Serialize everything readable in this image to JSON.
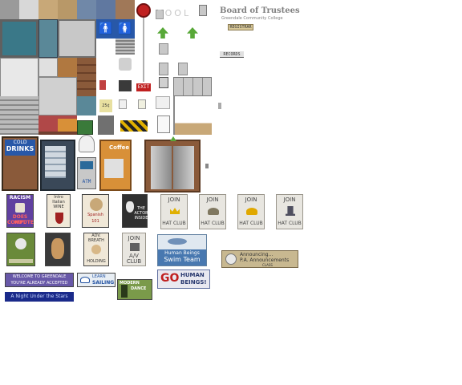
{
  "signs": {
    "pool": "POOL",
    "board_title": "Board of Trustees",
    "board_sub": "Greendale Community College",
    "registrar": "REGISTRAR",
    "records": "RECORDS",
    "exit": "EXIT",
    "cold_drinks_1": "COLD",
    "cold_drinks_2": "DRINKS",
    "coffee": "Coffee",
    "atm": "ATM",
    "price": "25¢"
  },
  "posters": {
    "racism_1": "RACISM",
    "racism_2": "DOES NOT",
    "racism_3": "COMPUTE",
    "wine_1": "Intro",
    "wine_2": "Italian",
    "wine_3": "WINE",
    "spanish_1": "Spanish",
    "spanish_2": "101",
    "actor_1": "THE",
    "actor_2": "ACTOR",
    "actor_3": "INSIDE",
    "join_word": "JOIN",
    "hat_club": "HAT CLUB",
    "breath_1": "ADV.",
    "breath_2": "BREATH",
    "breath_3": "HOLDING",
    "av_1": "JOIN",
    "av_2": "A/V",
    "av_3": "CLUB",
    "swim_1": "Human Beings",
    "swim_2": "Swim Team",
    "pa_1": "Announcing...",
    "pa_2": "P.A. Announcements",
    "pa_3": "CLASS",
    "welcome_1": "WELCOME TO GREENDALE",
    "welcome_2": "YOU'RE ALREADY ACCEPTED",
    "sailing_1": "LEARN",
    "sailing_2": "SAILING",
    "dance_1": "MODERN",
    "dance_2": "DANCE",
    "go_1": "GO",
    "go_2": "HUMAN",
    "go_3": "BEINGS!",
    "night": "A Night Under the Stars",
    "cold_label": "COLD DRINKS"
  },
  "colors": {
    "wall_tan": "#c8a878",
    "wall_blue": "#7088a8",
    "wall_brown": "#a07858",
    "window_teal": "#3a7888",
    "pool_gray": "#c8c8c8",
    "green_arrow": "#58a838",
    "exit_red": "#c02020",
    "elevator_brown": "#8a5a3a",
    "atm_blue": "#2050a0"
  }
}
